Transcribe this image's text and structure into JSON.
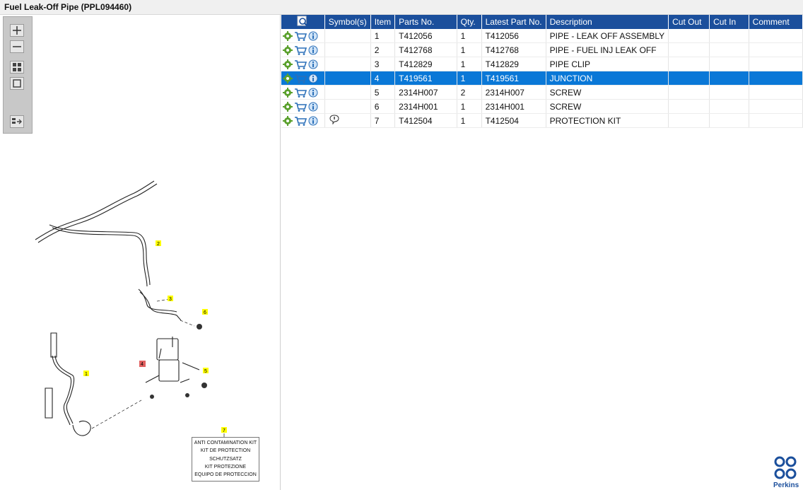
{
  "window": {
    "title": "Fuel Leak-Off Pipe (PPL094460)"
  },
  "toolbar": {
    "buttons": [
      "zoom-in-icon",
      "zoom-out-icon",
      "fit-icon",
      "actual-size-icon",
      "toggle-panel-icon"
    ]
  },
  "diagram": {
    "callouts": [
      "1",
      "2",
      "3",
      "4",
      "5",
      "6",
      "7"
    ],
    "kit_lines": [
      "ANTI CONTAMINATION KIT",
      "KIT DE PROTECTION",
      "SCHUTZSATZ",
      "KIT PROTEZIONE",
      "EQUIPO DE PROTECCION"
    ]
  },
  "table": {
    "headers": [
      "Symbol(s)",
      "Item",
      "Parts No.",
      "Qty.",
      "Latest Part No.",
      "Description",
      "Cut Out",
      "Cut In",
      "Comment"
    ],
    "rows": [
      {
        "symbol": "",
        "item": "1",
        "part": "T412056",
        "qty": "1",
        "latest": "T412056",
        "desc": "PIPE - LEAK OFF ASSEMBLY",
        "cut_out": "",
        "cut_in": "",
        "comment": ""
      },
      {
        "symbol": "",
        "item": "2",
        "part": "T412768",
        "qty": "1",
        "latest": "T412768",
        "desc": "PIPE - FUEL INJ LEAK OFF",
        "cut_out": "",
        "cut_in": "",
        "comment": ""
      },
      {
        "symbol": "",
        "item": "3",
        "part": "T412829",
        "qty": "1",
        "latest": "T412829",
        "desc": "PIPE CLIP",
        "cut_out": "",
        "cut_in": "",
        "comment": ""
      },
      {
        "symbol": "",
        "item": "4",
        "part": "T419561",
        "qty": "1",
        "latest": "T419561",
        "desc": "JUNCTION",
        "cut_out": "",
        "cut_in": "",
        "comment": ""
      },
      {
        "symbol": "",
        "item": "5",
        "part": "2314H007",
        "qty": "2",
        "latest": "2314H007",
        "desc": "SCREW",
        "cut_out": "",
        "cut_in": "",
        "comment": ""
      },
      {
        "symbol": "",
        "item": "6",
        "part": "2314H001",
        "qty": "1",
        "latest": "2314H001",
        "desc": "SCREW",
        "cut_out": "",
        "cut_in": "",
        "comment": ""
      },
      {
        "symbol": "note-icon",
        "item": "7",
        "part": "T412504",
        "qty": "1",
        "latest": "T412504",
        "desc": "PROTECTION KIT",
        "cut_out": "",
        "cut_in": "",
        "comment": ""
      }
    ],
    "selected_row": 3
  },
  "brand": {
    "name": "Perkins",
    "color": "#1b4f9c"
  },
  "colors": {
    "header": "#1b4f9c",
    "selected": "#0a78d7",
    "gear": "#5aa02c",
    "cart": "#2a6fb8"
  }
}
